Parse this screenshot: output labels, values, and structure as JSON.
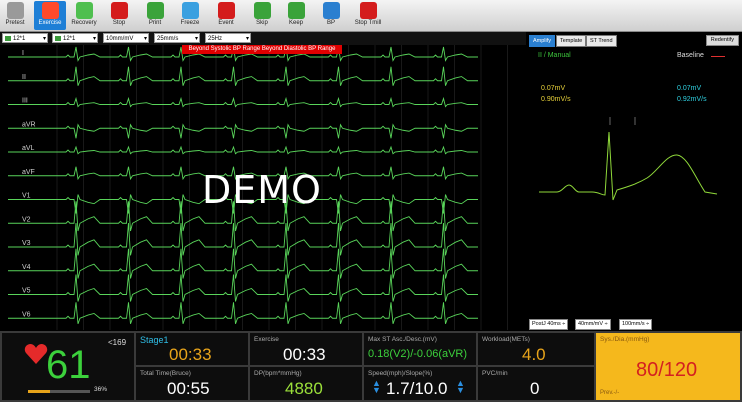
{
  "toolbar": {
    "buttons": [
      {
        "label": "Pretest",
        "icon": "person-pretest-icon",
        "color": "#9a9a9a",
        "active": false
      },
      {
        "label": "Exercise",
        "icon": "running-person-icon",
        "color": "#ff4a2a",
        "active": true
      },
      {
        "label": "Recovery",
        "icon": "walking-person-icon",
        "color": "#4fbf4f",
        "active": false
      },
      {
        "label": "Stop",
        "icon": "stop-target-icon",
        "color": "#d41c1c",
        "active": false
      },
      {
        "label": "Print",
        "icon": "printer-icon",
        "color": "#3aa33a",
        "active": false
      },
      {
        "label": "Freeze",
        "icon": "snowflake-icon",
        "color": "#3aa0e0",
        "active": false
      },
      {
        "label": "Event",
        "icon": "flag-icon",
        "color": "#d41c1c",
        "active": false
      },
      {
        "label": "Skip",
        "icon": "skip-forward-icon",
        "color": "#3aa33a",
        "active": false
      },
      {
        "label": "Keep",
        "icon": "pause-icon",
        "color": "#3aa33a",
        "active": false
      },
      {
        "label": "BP",
        "icon": "bp-gauge-icon",
        "color": "#2a7fd0",
        "active": false
      },
      {
        "label": "Stop Tmill",
        "icon": "stop-sign-icon",
        "color": "#d41c1c",
        "active": false
      }
    ]
  },
  "selectors": {
    "lead_format": "12*1",
    "lead_layout": "12*1",
    "gain": "10mm/mV",
    "speed": "25mm/s",
    "filter": "25Hz"
  },
  "alarm_text": "Beyond Systolic BP Range Beyond Diastolic BP Range",
  "leads": [
    "I",
    "II",
    "III",
    "aVR",
    "aVL",
    "aVF",
    "V1",
    "V2",
    "V3",
    "V4",
    "V5",
    "V6"
  ],
  "watermark": "DEMO",
  "right_panel": {
    "tabs": [
      "Amplify",
      "Template",
      "ST Trend"
    ],
    "redentify": "Redentify",
    "lead_label": "II / Manual",
    "baseline_label": "Baseline",
    "current_st": "0.07mV",
    "current_slope": "0.90mV/s",
    "baseline_st": "0.07mV",
    "baseline_slope": "0.92mV/s",
    "post_j": "PostJ 40ms",
    "gain": "40mm/mV",
    "speed": "100mm/s"
  },
  "bottom": {
    "heart_rate": "61",
    "target_hr": "<169",
    "hr_percent": "36%",
    "hr_progress": 0.36,
    "stage_label": "Stage1",
    "stage_time": "00:33",
    "exercise_label": "Exercise",
    "exercise_time": "00:33",
    "max_st_label": "Max ST Asc./Desc.(mV)",
    "max_st_value": "0.18(V2)/-0.06(aVR)",
    "workload_label": "Workload(METs)",
    "workload_value": "4.0",
    "bp_label": "Sys./Dia.(mmHg)",
    "bp_value": "80/120",
    "bp_prev": "Prev.-/-",
    "total_time_label": "Total Time(Bruce)",
    "total_time": "00:55",
    "dp_label": "DP(bpm*mmHg)",
    "dp_value": "4880",
    "speed_label": "Speed(mph)/Slope(%)",
    "speed_value": "1.7/10.0",
    "pvc_label": "PVC/min",
    "pvc_value": "0"
  }
}
